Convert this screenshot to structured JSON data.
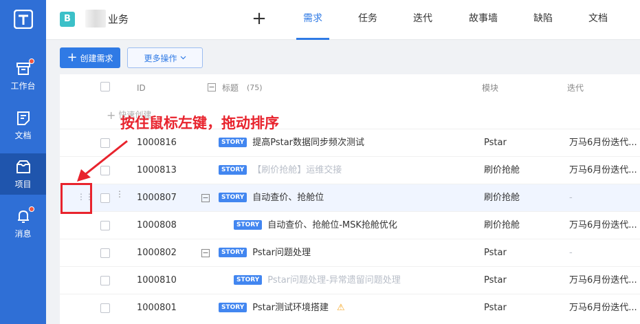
{
  "sidebar": {
    "items": [
      {
        "label": "工作台",
        "icon": "inbox-icon",
        "badge": true
      },
      {
        "label": "文档",
        "icon": "document-icon",
        "badge": false
      },
      {
        "label": "项目",
        "icon": "project-box-icon",
        "badge": false,
        "active": true
      },
      {
        "label": "消息",
        "icon": "bell-icon",
        "badge": true
      }
    ]
  },
  "topbar": {
    "project_badge": "B",
    "project_name": "业务",
    "add_label": "+",
    "tabs": [
      "需求",
      "任务",
      "迭代",
      "故事墙",
      "缺陷",
      "文档"
    ],
    "active_tab": "需求"
  },
  "toolbar": {
    "create_label": "创建需求",
    "more_label": "更多操作"
  },
  "table": {
    "columns": {
      "id": "ID",
      "title": "标题",
      "count": "(75)",
      "module": "模块",
      "iteration": "迭代"
    },
    "quick_create": "快速创建",
    "tag": "STORY",
    "rows": [
      {
        "id": "1000816",
        "title": "提高Pstar数据同步频次测试",
        "module": "Pstar",
        "iteration": "万马6月份迭代..."
      },
      {
        "id": "1000813",
        "title": "【刷价抢舱】运维交接",
        "module": "刷价抢舱",
        "iteration": "万马6月份迭代..."
      },
      {
        "id": "1000807",
        "title": "自动查价、抢舱位",
        "module": "刷价抢舱",
        "iteration": "-"
      },
      {
        "id": "1000808",
        "title": "自动查价、抢舱位-MSK抢舱优化",
        "module": "刷价抢舱",
        "iteration": "万马6月份迭代..."
      },
      {
        "id": "1000802",
        "title": "Pstar问题处理",
        "module": "Pstar",
        "iteration": "-"
      },
      {
        "id": "1000810",
        "title": "Pstar问题处理-异常遗留问题处理",
        "module": "Pstar",
        "iteration": "万马6月份迭代..."
      },
      {
        "id": "1000801",
        "title": "Pstar测试环境搭建",
        "module": "Pstar",
        "iteration": "万马6月份迭代..."
      }
    ]
  },
  "annotation": {
    "text": "按住鼠标左键，拖动排序",
    "color": "#e8232d"
  },
  "colors": {
    "sidebar": "#2f6fd6",
    "accent": "#2f7ae5",
    "tag": "#4286f0"
  }
}
